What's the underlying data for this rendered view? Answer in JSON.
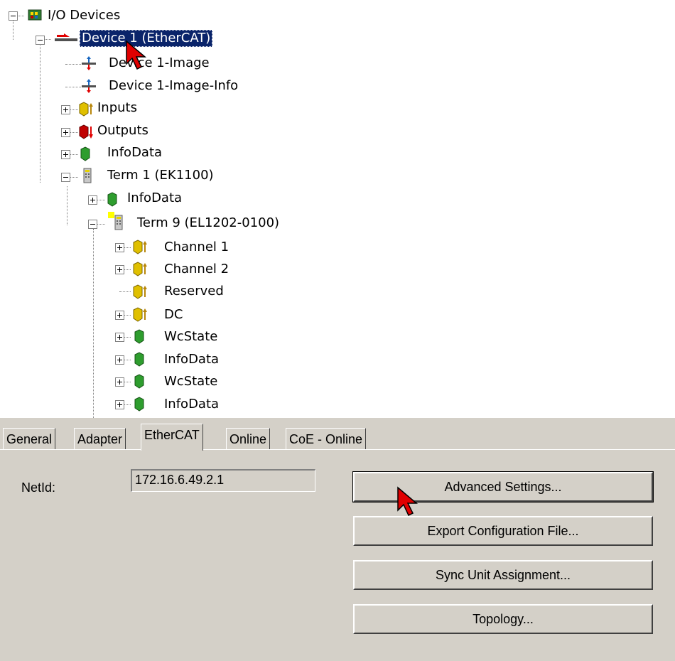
{
  "tree": {
    "root": {
      "label": "I/O Devices",
      "icon": "io-devices-icon"
    },
    "device": {
      "label": "Device 1 (EtherCAT)",
      "icon": "ethercat-device-icon",
      "selected": true
    },
    "items": [
      {
        "label": "Device 1-Image",
        "icon": "process-image-icon"
      },
      {
        "label": "Device 1-Image-Info",
        "icon": "process-image-icon"
      },
      {
        "label": "Inputs",
        "icon": "inputs-icon"
      },
      {
        "label": "Outputs",
        "icon": "outputs-icon"
      },
      {
        "label": "InfoData",
        "icon": "infodata-icon"
      },
      {
        "label": "Term 1 (EK1100)",
        "icon": "terminal-icon"
      },
      {
        "label": "InfoData",
        "icon": "infodata-icon"
      },
      {
        "label": "Term 9 (EL1202-0100)",
        "icon": "terminal-icon"
      },
      {
        "label": "Channel 1",
        "icon": "inputs-icon"
      },
      {
        "label": "Channel 2",
        "icon": "inputs-icon"
      },
      {
        "label": "Reserved",
        "icon": "inputs-icon"
      },
      {
        "label": "DC",
        "icon": "inputs-icon"
      },
      {
        "label": "WcState",
        "icon": "infodata-icon"
      },
      {
        "label": "InfoData",
        "icon": "infodata-icon"
      },
      {
        "label": "WcState",
        "icon": "infodata-icon"
      },
      {
        "label": "InfoData",
        "icon": "infodata-icon"
      }
    ]
  },
  "tabs": [
    {
      "label": "General",
      "active": false
    },
    {
      "label": "Adapter",
      "active": false
    },
    {
      "label": "EtherCAT",
      "active": true
    },
    {
      "label": "Online",
      "active": false
    },
    {
      "label": "CoE - Online",
      "active": false
    }
  ],
  "ethercat": {
    "netid_label": "NetId:",
    "netid_value": "172.16.6.49.2.1",
    "buttons": {
      "advanced": "Advanced Settings...",
      "export": "Export Configuration File...",
      "sync": "Sync Unit Assignment...",
      "topology": "Topology..."
    }
  },
  "colors": {
    "selection": "#0a246a",
    "panel": "#d4d0c8",
    "cursor": "#e00000"
  }
}
